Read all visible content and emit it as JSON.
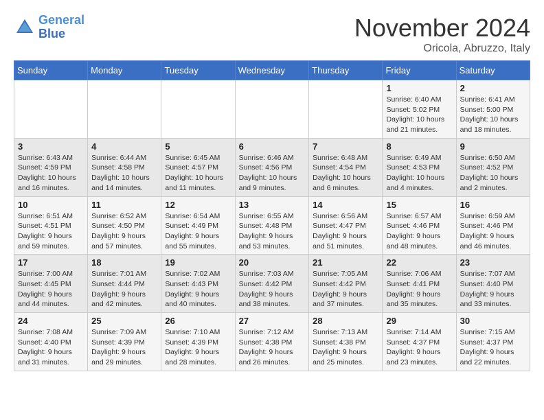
{
  "logo": {
    "line1": "General",
    "line2": "Blue"
  },
  "title": "November 2024",
  "location": "Oricola, Abruzzo, Italy",
  "weekdays": [
    "Sunday",
    "Monday",
    "Tuesday",
    "Wednesday",
    "Thursday",
    "Friday",
    "Saturday"
  ],
  "weeks": [
    [
      {
        "day": "",
        "sunrise": "",
        "sunset": "",
        "daylight": ""
      },
      {
        "day": "",
        "sunrise": "",
        "sunset": "",
        "daylight": ""
      },
      {
        "day": "",
        "sunrise": "",
        "sunset": "",
        "daylight": ""
      },
      {
        "day": "",
        "sunrise": "",
        "sunset": "",
        "daylight": ""
      },
      {
        "day": "",
        "sunrise": "",
        "sunset": "",
        "daylight": ""
      },
      {
        "day": "1",
        "sunrise": "Sunrise: 6:40 AM",
        "sunset": "Sunset: 5:02 PM",
        "daylight": "Daylight: 10 hours and 21 minutes."
      },
      {
        "day": "2",
        "sunrise": "Sunrise: 6:41 AM",
        "sunset": "Sunset: 5:00 PM",
        "daylight": "Daylight: 10 hours and 18 minutes."
      }
    ],
    [
      {
        "day": "3",
        "sunrise": "Sunrise: 6:43 AM",
        "sunset": "Sunset: 4:59 PM",
        "daylight": "Daylight: 10 hours and 16 minutes."
      },
      {
        "day": "4",
        "sunrise": "Sunrise: 6:44 AM",
        "sunset": "Sunset: 4:58 PM",
        "daylight": "Daylight: 10 hours and 14 minutes."
      },
      {
        "day": "5",
        "sunrise": "Sunrise: 6:45 AM",
        "sunset": "Sunset: 4:57 PM",
        "daylight": "Daylight: 10 hours and 11 minutes."
      },
      {
        "day": "6",
        "sunrise": "Sunrise: 6:46 AM",
        "sunset": "Sunset: 4:56 PM",
        "daylight": "Daylight: 10 hours and 9 minutes."
      },
      {
        "day": "7",
        "sunrise": "Sunrise: 6:48 AM",
        "sunset": "Sunset: 4:54 PM",
        "daylight": "Daylight: 10 hours and 6 minutes."
      },
      {
        "day": "8",
        "sunrise": "Sunrise: 6:49 AM",
        "sunset": "Sunset: 4:53 PM",
        "daylight": "Daylight: 10 hours and 4 minutes."
      },
      {
        "day": "9",
        "sunrise": "Sunrise: 6:50 AM",
        "sunset": "Sunset: 4:52 PM",
        "daylight": "Daylight: 10 hours and 2 minutes."
      }
    ],
    [
      {
        "day": "10",
        "sunrise": "Sunrise: 6:51 AM",
        "sunset": "Sunset: 4:51 PM",
        "daylight": "Daylight: 9 hours and 59 minutes."
      },
      {
        "day": "11",
        "sunrise": "Sunrise: 6:52 AM",
        "sunset": "Sunset: 4:50 PM",
        "daylight": "Daylight: 9 hours and 57 minutes."
      },
      {
        "day": "12",
        "sunrise": "Sunrise: 6:54 AM",
        "sunset": "Sunset: 4:49 PM",
        "daylight": "Daylight: 9 hours and 55 minutes."
      },
      {
        "day": "13",
        "sunrise": "Sunrise: 6:55 AM",
        "sunset": "Sunset: 4:48 PM",
        "daylight": "Daylight: 9 hours and 53 minutes."
      },
      {
        "day": "14",
        "sunrise": "Sunrise: 6:56 AM",
        "sunset": "Sunset: 4:47 PM",
        "daylight": "Daylight: 9 hours and 51 minutes."
      },
      {
        "day": "15",
        "sunrise": "Sunrise: 6:57 AM",
        "sunset": "Sunset: 4:46 PM",
        "daylight": "Daylight: 9 hours and 48 minutes."
      },
      {
        "day": "16",
        "sunrise": "Sunrise: 6:59 AM",
        "sunset": "Sunset: 4:46 PM",
        "daylight": "Daylight: 9 hours and 46 minutes."
      }
    ],
    [
      {
        "day": "17",
        "sunrise": "Sunrise: 7:00 AM",
        "sunset": "Sunset: 4:45 PM",
        "daylight": "Daylight: 9 hours and 44 minutes."
      },
      {
        "day": "18",
        "sunrise": "Sunrise: 7:01 AM",
        "sunset": "Sunset: 4:44 PM",
        "daylight": "Daylight: 9 hours and 42 minutes."
      },
      {
        "day": "19",
        "sunrise": "Sunrise: 7:02 AM",
        "sunset": "Sunset: 4:43 PM",
        "daylight": "Daylight: 9 hours and 40 minutes."
      },
      {
        "day": "20",
        "sunrise": "Sunrise: 7:03 AM",
        "sunset": "Sunset: 4:42 PM",
        "daylight": "Daylight: 9 hours and 38 minutes."
      },
      {
        "day": "21",
        "sunrise": "Sunrise: 7:05 AM",
        "sunset": "Sunset: 4:42 PM",
        "daylight": "Daylight: 9 hours and 37 minutes."
      },
      {
        "day": "22",
        "sunrise": "Sunrise: 7:06 AM",
        "sunset": "Sunset: 4:41 PM",
        "daylight": "Daylight: 9 hours and 35 minutes."
      },
      {
        "day": "23",
        "sunrise": "Sunrise: 7:07 AM",
        "sunset": "Sunset: 4:40 PM",
        "daylight": "Daylight: 9 hours and 33 minutes."
      }
    ],
    [
      {
        "day": "24",
        "sunrise": "Sunrise: 7:08 AM",
        "sunset": "Sunset: 4:40 PM",
        "daylight": "Daylight: 9 hours and 31 minutes."
      },
      {
        "day": "25",
        "sunrise": "Sunrise: 7:09 AM",
        "sunset": "Sunset: 4:39 PM",
        "daylight": "Daylight: 9 hours and 29 minutes."
      },
      {
        "day": "26",
        "sunrise": "Sunrise: 7:10 AM",
        "sunset": "Sunset: 4:39 PM",
        "daylight": "Daylight: 9 hours and 28 minutes."
      },
      {
        "day": "27",
        "sunrise": "Sunrise: 7:12 AM",
        "sunset": "Sunset: 4:38 PM",
        "daylight": "Daylight: 9 hours and 26 minutes."
      },
      {
        "day": "28",
        "sunrise": "Sunrise: 7:13 AM",
        "sunset": "Sunset: 4:38 PM",
        "daylight": "Daylight: 9 hours and 25 minutes."
      },
      {
        "day": "29",
        "sunrise": "Sunrise: 7:14 AM",
        "sunset": "Sunset: 4:37 PM",
        "daylight": "Daylight: 9 hours and 23 minutes."
      },
      {
        "day": "30",
        "sunrise": "Sunrise: 7:15 AM",
        "sunset": "Sunset: 4:37 PM",
        "daylight": "Daylight: 9 hours and 22 minutes."
      }
    ]
  ]
}
